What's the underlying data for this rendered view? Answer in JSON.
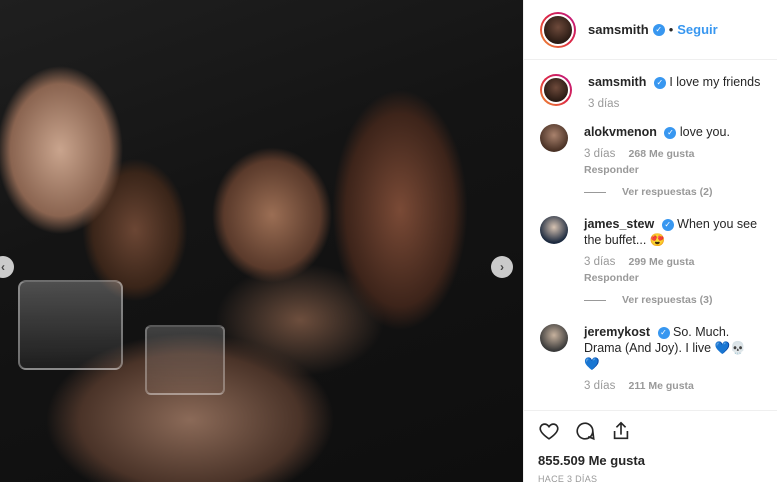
{
  "header": {
    "username": "samsmith",
    "follow_label": "Seguir",
    "separator": "•"
  },
  "caption": {
    "username": "samsmith",
    "text": "I love my friends",
    "time": "3 días"
  },
  "comments": [
    {
      "username": "alokvmenon",
      "text": "love you.",
      "time": "3 días",
      "likes": "268 Me gusta",
      "reply_label": "Responder",
      "view_replies": "Ver respuestas (2)"
    },
    {
      "username": "james_stew",
      "text": "When you see the buffet... 😍",
      "time": "3 días",
      "likes": "299 Me gusta",
      "reply_label": "Responder",
      "view_replies": "Ver respuestas (3)"
    },
    {
      "username": "jeremykost",
      "text": "So. Much. Drama (And Joy). I live 💙💀💙",
      "time": "3 días",
      "likes": "211 Me gusta"
    }
  ],
  "post": {
    "likes_count": "855.509 Me gusta",
    "posted_ago": "HACE 3 DÍAS"
  },
  "icons": {
    "prev": "chevron-left-icon",
    "next": "chevron-right-icon",
    "like": "heart-icon",
    "comment": "comment-icon",
    "share": "share-icon",
    "verified": "verified-badge-icon"
  },
  "colors": {
    "accent": "#3897f0",
    "text": "#262626",
    "muted": "#999999",
    "border": "#efefef"
  }
}
